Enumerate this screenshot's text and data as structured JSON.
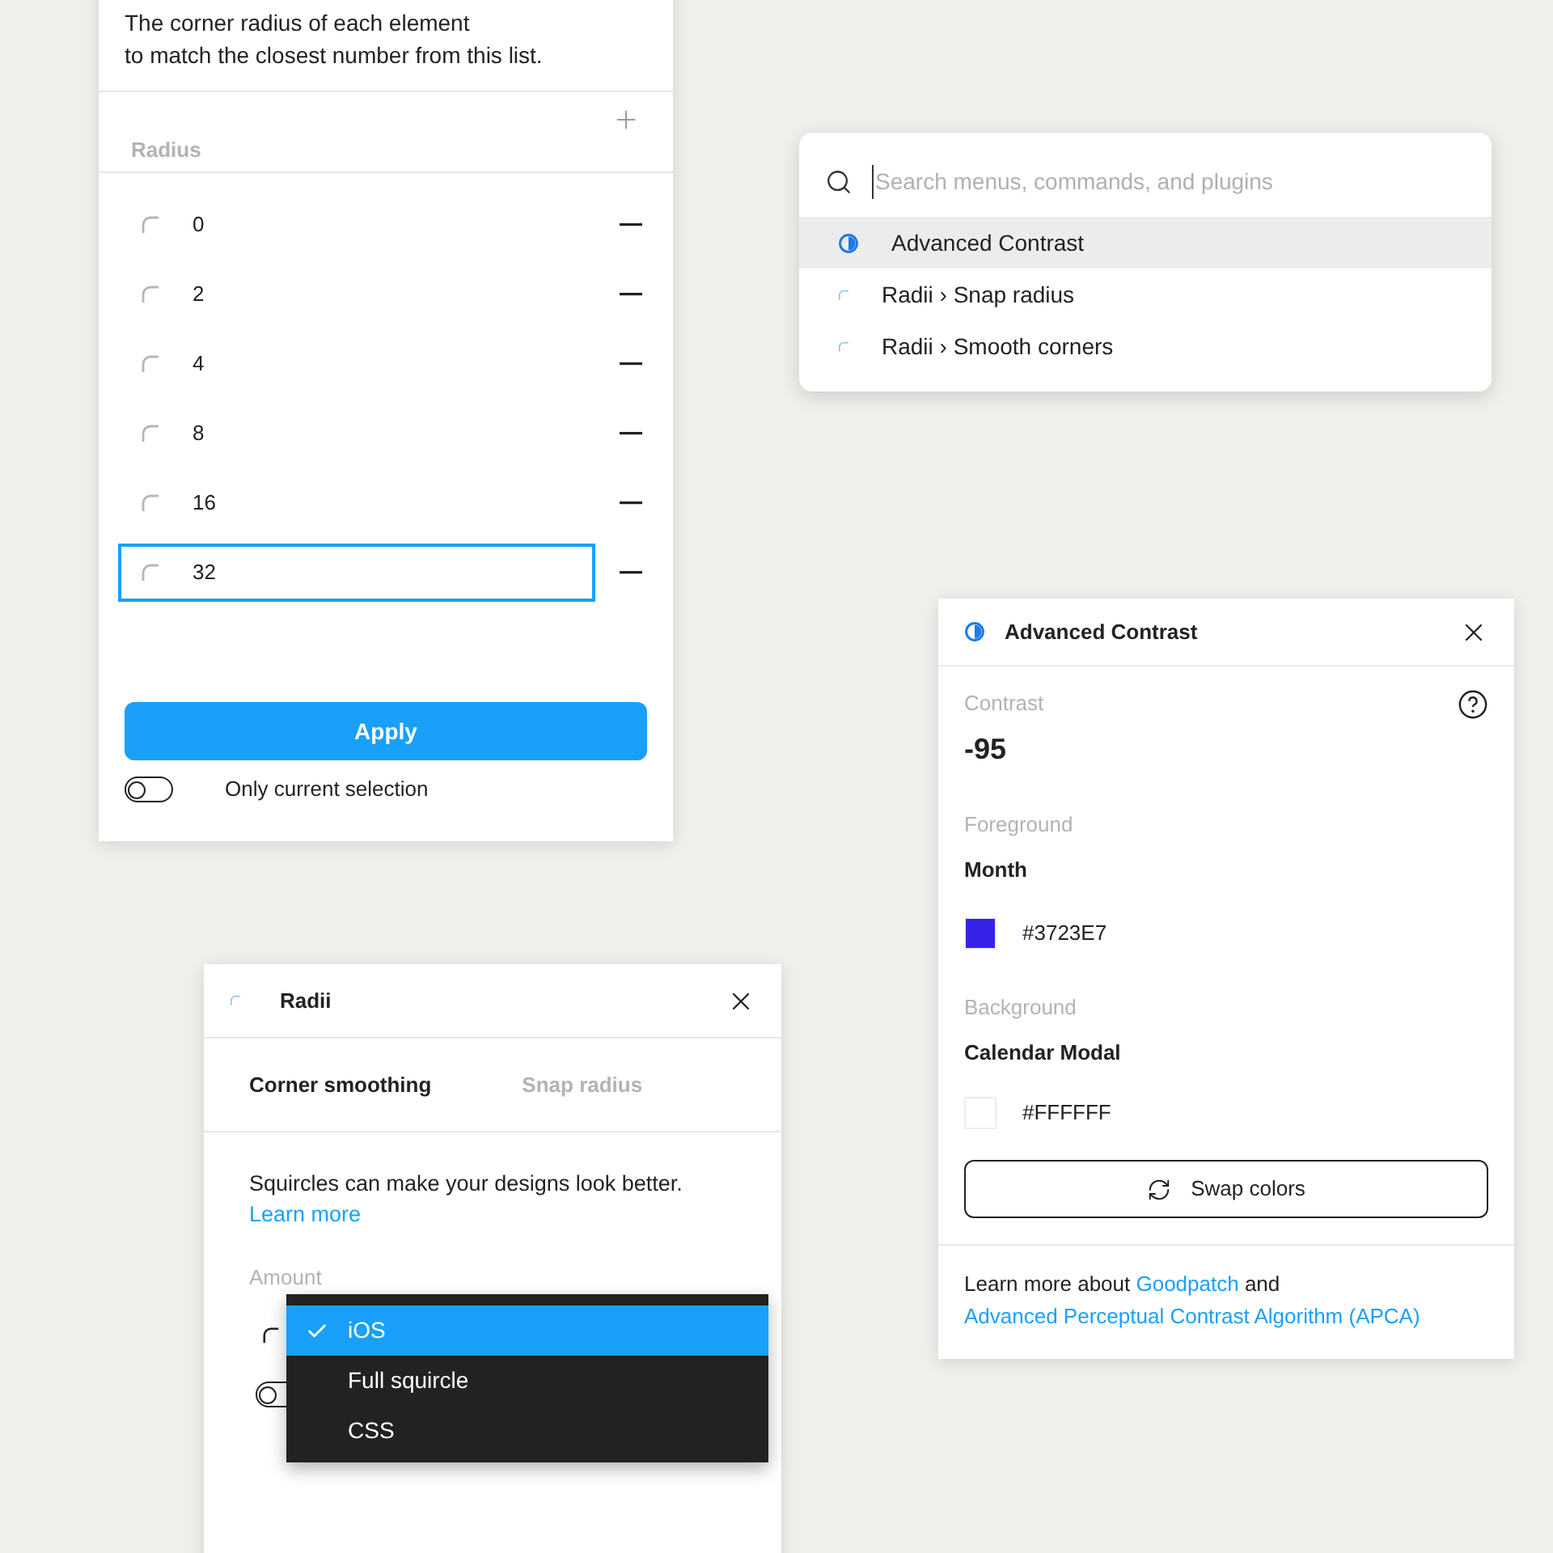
{
  "snap_panel": {
    "intro_lines": [
      "The corner radius of each element",
      "to match the closest number from this list."
    ],
    "section_label": "Radius",
    "rows": [
      {
        "value": "0",
        "focused": false
      },
      {
        "value": "2",
        "focused": false
      },
      {
        "value": "4",
        "focused": false
      },
      {
        "value": "8",
        "focused": false
      },
      {
        "value": "16",
        "focused": false
      },
      {
        "value": "32",
        "focused": true
      }
    ],
    "apply_label": "Apply",
    "toggle": {
      "label": "Only current selection",
      "on": false
    }
  },
  "command_palette": {
    "placeholder": "Search menus, commands, and plugins",
    "results": [
      {
        "kind": "contrast",
        "text": "Advanced Contrast",
        "selected": true
      },
      {
        "kind": "radii",
        "text": "Radii › Snap radius",
        "selected": false
      },
      {
        "kind": "radii",
        "text": "Radii › Smooth corners",
        "selected": false
      }
    ]
  },
  "contrast_panel": {
    "title": "Advanced Contrast",
    "contrast_label": "Contrast",
    "contrast_value": "-95",
    "colors": [
      {
        "label": "Foreground",
        "name": "Month",
        "hex": "#3723E7",
        "color": "#3723e7"
      },
      {
        "label": "Background",
        "name": "Calendar Modal",
        "hex": "#FFFFFF",
        "color": "#ffffff"
      }
    ],
    "swap_label": "Swap colors",
    "footer": [
      {
        "text": "Learn more about ",
        "link": false
      },
      {
        "text": "Goodpatch",
        "link": true
      },
      {
        "text": " and ",
        "link": false
      },
      {
        "text": "Advanced Perceptual Contrast Algorithm (APCA)",
        "link": true
      }
    ]
  },
  "radii_panel": {
    "title": "Radii",
    "tabs": [
      {
        "label": "Corner smoothing",
        "selected": true
      },
      {
        "label": "Snap radius",
        "selected": false
      }
    ],
    "description": "Squircles can make your designs look better.",
    "link": "Learn more",
    "amount_label": "Amount",
    "toggle": {
      "on": false
    },
    "menu": [
      {
        "label": "iOS",
        "selected": true
      },
      {
        "label": "Full squircle",
        "selected": false
      },
      {
        "label": "CSS",
        "selected": false
      }
    ]
  }
}
